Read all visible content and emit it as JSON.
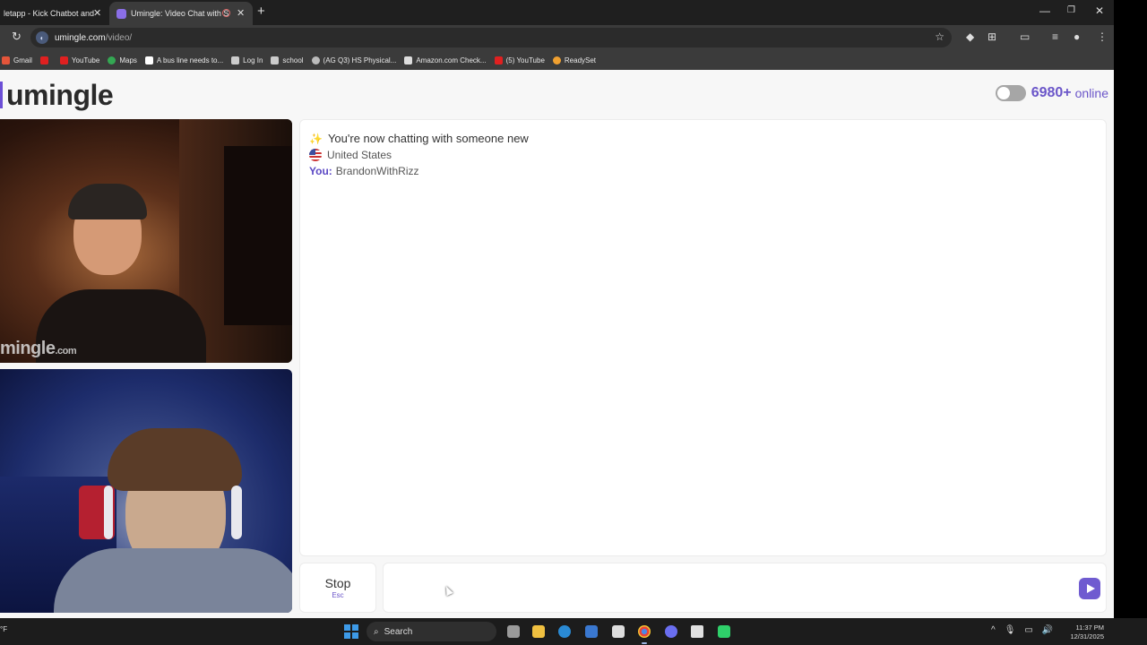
{
  "browser": {
    "tabs": [
      {
        "title": "letapp - Kick Chatbot and",
        "active": false
      },
      {
        "title": "Umingle: Video Chat with S",
        "active": true
      }
    ],
    "url_host": "umingle.com",
    "url_path": "/video/",
    "bookmarks": [
      {
        "label": "Gmail",
        "icon_color": "#e4553a"
      },
      {
        "label": "",
        "icon_color": "#e02020"
      },
      {
        "label": "YouTube",
        "icon_color": "#e02020"
      },
      {
        "label": "Maps",
        "icon_color": "#34a853"
      },
      {
        "label": "A bus line needs to...",
        "icon_color": "#ffffff"
      },
      {
        "label": "Log In",
        "icon_color": "#cccccc"
      },
      {
        "label": "school",
        "icon_color": "#cccccc"
      },
      {
        "label": "(AG Q3) HS Physical...",
        "icon_color": "#bbbbbb"
      },
      {
        "label": "Amazon.com Check...",
        "icon_color": "#dddddd"
      },
      {
        "label": "(5) YouTube",
        "icon_color": "#e02020"
      },
      {
        "label": "ReadySet",
        "icon_color": "#f0a030"
      }
    ]
  },
  "page": {
    "logo": "umingle",
    "online_count": "6980+",
    "online_label": "online",
    "stranger_watermark": "mingle",
    "stranger_watermark_suffix": ".com",
    "chat": {
      "status_emoji": "✨",
      "status": "You're now chatting with someone new",
      "country": "United States",
      "you_label": "You:",
      "you_name": "BrandonWithRizz"
    },
    "stop_label": "Stop",
    "stop_hint": "Esc",
    "message_placeholder": ""
  },
  "taskbar": {
    "weather": "°F",
    "search_label": "Search",
    "time": "11:37 PM",
    "date": "12/31/2025"
  },
  "colors": {
    "accent": "#6b56c9",
    "logo_text": "#2a2a2a",
    "page_bg": "#f7f7f7"
  }
}
